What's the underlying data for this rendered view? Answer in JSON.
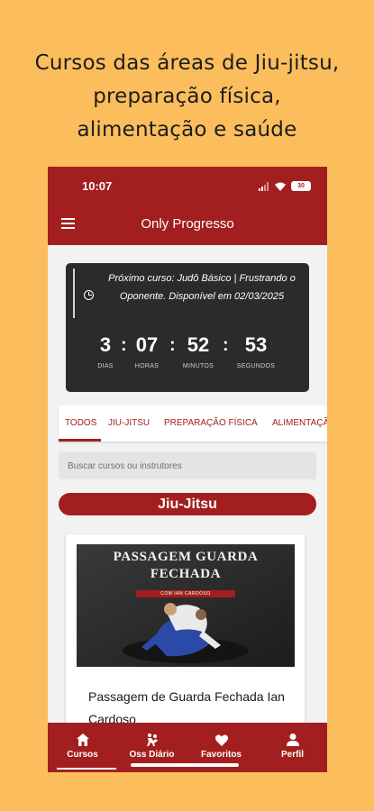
{
  "headline": {
    "line1": "Cursos das áreas de Jiu-jitsu,",
    "line2": "preparação física,",
    "line3": "alimentação e saúde"
  },
  "status_bar": {
    "time": "10:07",
    "battery": "30"
  },
  "app_bar": {
    "title": "Only Progresso",
    "menu_icon": "hamburger-icon"
  },
  "countdown": {
    "text": "Próximo curso: Judô Básico | Frustrando o Oponente. Disponível em 02/03/2025",
    "days": "3",
    "days_label": "DIAS",
    "hours": "07",
    "hours_label": "HORAS",
    "minutes": "52",
    "minutes_label": "MINUTOS",
    "seconds": "53",
    "seconds_label": "SEGUNDOS"
  },
  "tabs": [
    "TODOS",
    "JIU-JITSU",
    "PREPARAÇÃO FÍSICA",
    "ALIMENTAÇÃO"
  ],
  "search": {
    "placeholder": "Buscar cursos ou instrutores"
  },
  "section": {
    "title": "Jiu-Jitsu"
  },
  "course_card": {
    "thumb_title": "PASSAGEM GUARDA FECHADA",
    "thumb_subtitle": "COM IAN CARDOSO",
    "title": "Passagem de Guarda Fechada Ian Cardoso"
  },
  "bottom_nav": [
    {
      "label": "Cursos",
      "icon": "home-icon"
    },
    {
      "label": "Oss Diário",
      "icon": "fighters-icon"
    },
    {
      "label": "Favoritos",
      "icon": "heart-icon"
    },
    {
      "label": "Perfil",
      "icon": "person-icon"
    }
  ],
  "colors": {
    "background": "#FCBE5D",
    "primary": "#A31F1F",
    "countdown_bg": "#2b2b2b"
  }
}
